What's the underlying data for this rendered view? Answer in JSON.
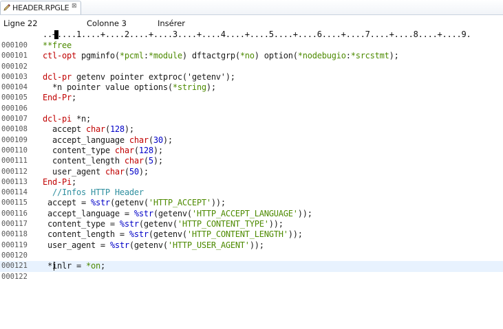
{
  "tab": {
    "title": "HEADER.RPGLE",
    "close_glyph": "⊠",
    "icon": "pencil-edit-icon"
  },
  "status": {
    "line": "Ligne 22",
    "column": "Colonne 3",
    "mode": "Insérer"
  },
  "ruler": "..+....1....+....2....+....3....+....4....+....5....+....6....+....7....+....8....+....9.",
  "colors": {
    "keyword": "#c00000",
    "builtin": "#0000c8",
    "special": "#4d8a00",
    "comment": "#2f8f9f",
    "current_line": "#e8f2fe"
  },
  "lines": [
    {
      "num": "000100",
      "tokens": [
        {
          "t": "**free",
          "c": "gr"
        }
      ]
    },
    {
      "num": "000101",
      "tokens": [
        {
          "t": "ctl-opt",
          "c": "kw"
        },
        {
          "t": " pgminfo(",
          "c": "df"
        },
        {
          "t": "*pcml",
          "c": "gr"
        },
        {
          "t": ":",
          "c": "df"
        },
        {
          "t": "*module",
          "c": "gr"
        },
        {
          "t": ") dftactgrp(",
          "c": "df"
        },
        {
          "t": "*no",
          "c": "gr"
        },
        {
          "t": ") option(",
          "c": "df"
        },
        {
          "t": "*nodebugio",
          "c": "gr"
        },
        {
          "t": ":",
          "c": "df"
        },
        {
          "t": "*srcstmt",
          "c": "gr"
        },
        {
          "t": ");",
          "c": "df"
        }
      ]
    },
    {
      "num": "000102",
      "tokens": []
    },
    {
      "num": "000103",
      "tokens": [
        {
          "t": "dcl-pr",
          "c": "kw"
        },
        {
          "t": " getenv pointer extproc('getenv');",
          "c": "df"
        }
      ]
    },
    {
      "num": "000104",
      "tokens": [
        {
          "t": "  *n pointer value options(",
          "c": "df"
        },
        {
          "t": "*string",
          "c": "gr"
        },
        {
          "t": ");",
          "c": "df"
        }
      ]
    },
    {
      "num": "000105",
      "tokens": [
        {
          "t": "End-Pr",
          "c": "kw"
        },
        {
          "t": ";",
          "c": "df"
        }
      ]
    },
    {
      "num": "000106",
      "tokens": []
    },
    {
      "num": "000107",
      "tokens": [
        {
          "t": "dcl-pi",
          "c": "kw"
        },
        {
          "t": " *n;",
          "c": "df"
        }
      ]
    },
    {
      "num": "000108",
      "tokens": [
        {
          "t": "  accept ",
          "c": "df"
        },
        {
          "t": "char",
          "c": "kw"
        },
        {
          "t": "(",
          "c": "df"
        },
        {
          "t": "128",
          "c": "bl"
        },
        {
          "t": ");",
          "c": "df"
        }
      ]
    },
    {
      "num": "000109",
      "tokens": [
        {
          "t": "  accept_language ",
          "c": "df"
        },
        {
          "t": "char",
          "c": "kw"
        },
        {
          "t": "(",
          "c": "df"
        },
        {
          "t": "30",
          "c": "bl"
        },
        {
          "t": ");",
          "c": "df"
        }
      ]
    },
    {
      "num": "000110",
      "tokens": [
        {
          "t": "  content_type ",
          "c": "df"
        },
        {
          "t": "char",
          "c": "kw"
        },
        {
          "t": "(",
          "c": "df"
        },
        {
          "t": "128",
          "c": "bl"
        },
        {
          "t": ");",
          "c": "df"
        }
      ]
    },
    {
      "num": "000111",
      "tokens": [
        {
          "t": "  content_length ",
          "c": "df"
        },
        {
          "t": "char",
          "c": "kw"
        },
        {
          "t": "(",
          "c": "df"
        },
        {
          "t": "5",
          "c": "bl"
        },
        {
          "t": ");",
          "c": "df"
        }
      ]
    },
    {
      "num": "000112",
      "tokens": [
        {
          "t": "  user_agent ",
          "c": "df"
        },
        {
          "t": "char",
          "c": "kw"
        },
        {
          "t": "(",
          "c": "df"
        },
        {
          "t": "50",
          "c": "bl"
        },
        {
          "t": ");",
          "c": "df"
        }
      ]
    },
    {
      "num": "000113",
      "tokens": [
        {
          "t": "End-Pi",
          "c": "kw"
        },
        {
          "t": ";",
          "c": "df"
        }
      ]
    },
    {
      "num": "000114",
      "tokens": [
        {
          "t": "  //Infos HTTP Header",
          "c": "cm"
        }
      ]
    },
    {
      "num": "000115",
      "tokens": [
        {
          "t": " accept = ",
          "c": "df"
        },
        {
          "t": "%str",
          "c": "bl"
        },
        {
          "t": "(getenv(",
          "c": "df"
        },
        {
          "t": "'HTTP_ACCEPT'",
          "c": "gr"
        },
        {
          "t": "));",
          "c": "df"
        }
      ]
    },
    {
      "num": "000116",
      "tokens": [
        {
          "t": " accept_language = ",
          "c": "df"
        },
        {
          "t": "%str",
          "c": "bl"
        },
        {
          "t": "(getenv(",
          "c": "df"
        },
        {
          "t": "'HTTP_ACCEPT_LANGUAGE'",
          "c": "gr"
        },
        {
          "t": "));",
          "c": "df"
        }
      ]
    },
    {
      "num": "000117",
      "tokens": [
        {
          "t": " content_type = ",
          "c": "df"
        },
        {
          "t": "%str",
          "c": "bl"
        },
        {
          "t": "(getenv(",
          "c": "df"
        },
        {
          "t": "'HTTP_CONTENT_TYPE'",
          "c": "gr"
        },
        {
          "t": "));",
          "c": "df"
        }
      ]
    },
    {
      "num": "000118",
      "tokens": [
        {
          "t": " content_length = ",
          "c": "df"
        },
        {
          "t": "%str",
          "c": "bl"
        },
        {
          "t": "(getenv(",
          "c": "df"
        },
        {
          "t": "'HTTP_CONTENT_LENGTH'",
          "c": "gr"
        },
        {
          "t": "));",
          "c": "df"
        }
      ]
    },
    {
      "num": "000119",
      "tokens": [
        {
          "t": " user_agent = ",
          "c": "df"
        },
        {
          "t": "%str",
          "c": "bl"
        },
        {
          "t": "(getenv(",
          "c": "df"
        },
        {
          "t": "'HTTP_USER_AGENT'",
          "c": "gr"
        },
        {
          "t": "));",
          "c": "df"
        }
      ]
    },
    {
      "num": "000120",
      "tokens": []
    },
    {
      "num": "000121",
      "current": true,
      "tokens": [
        {
          "t": " *inlr = ",
          "c": "df"
        },
        {
          "t": "*on",
          "c": "gr"
        },
        {
          "t": ";",
          "c": "df"
        }
      ]
    },
    {
      "num": "000122",
      "tokens": []
    }
  ]
}
